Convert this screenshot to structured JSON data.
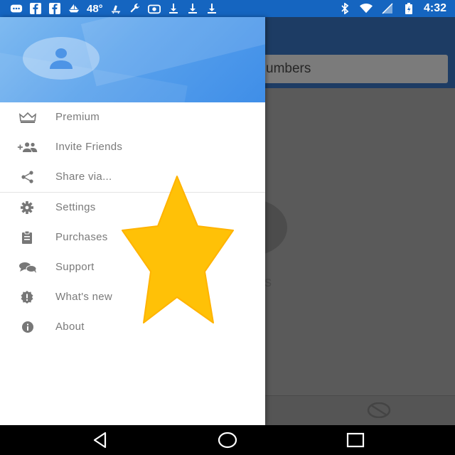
{
  "status_bar": {
    "temperature": "48°",
    "time": "4:32",
    "icons": [
      "message-icon",
      "facebook-icon",
      "facebook-icon",
      "boat-icon",
      "weather-icon",
      "skate-icon",
      "wrench-icon",
      "camera-icon",
      "download-icon",
      "download-icon",
      "download-icon",
      "bluetooth-icon",
      "wifi-icon",
      "signal-icon",
      "battery-icon"
    ]
  },
  "background_app": {
    "search_text": "umbers"
  },
  "drawer": {
    "items": [
      {
        "label": "Premium",
        "icon": "crown-icon"
      },
      {
        "label": "Invite Friends",
        "icon": "add-people-icon"
      },
      {
        "label": "Share via...",
        "icon": "share-icon"
      },
      {
        "label": "Settings",
        "icon": "gear-icon"
      },
      {
        "label": "Purchases",
        "icon": "clipboard-icon"
      },
      {
        "label": "Support",
        "icon": "chat-icon"
      },
      {
        "label": "What's new",
        "icon": "new-badge-icon"
      },
      {
        "label": "About",
        "icon": "info-icon"
      }
    ]
  },
  "colors": {
    "status_bar": "#1565c0",
    "header_blue": "#4f9bea",
    "star": "#ffc107",
    "menu_text": "#7a7a7a"
  }
}
